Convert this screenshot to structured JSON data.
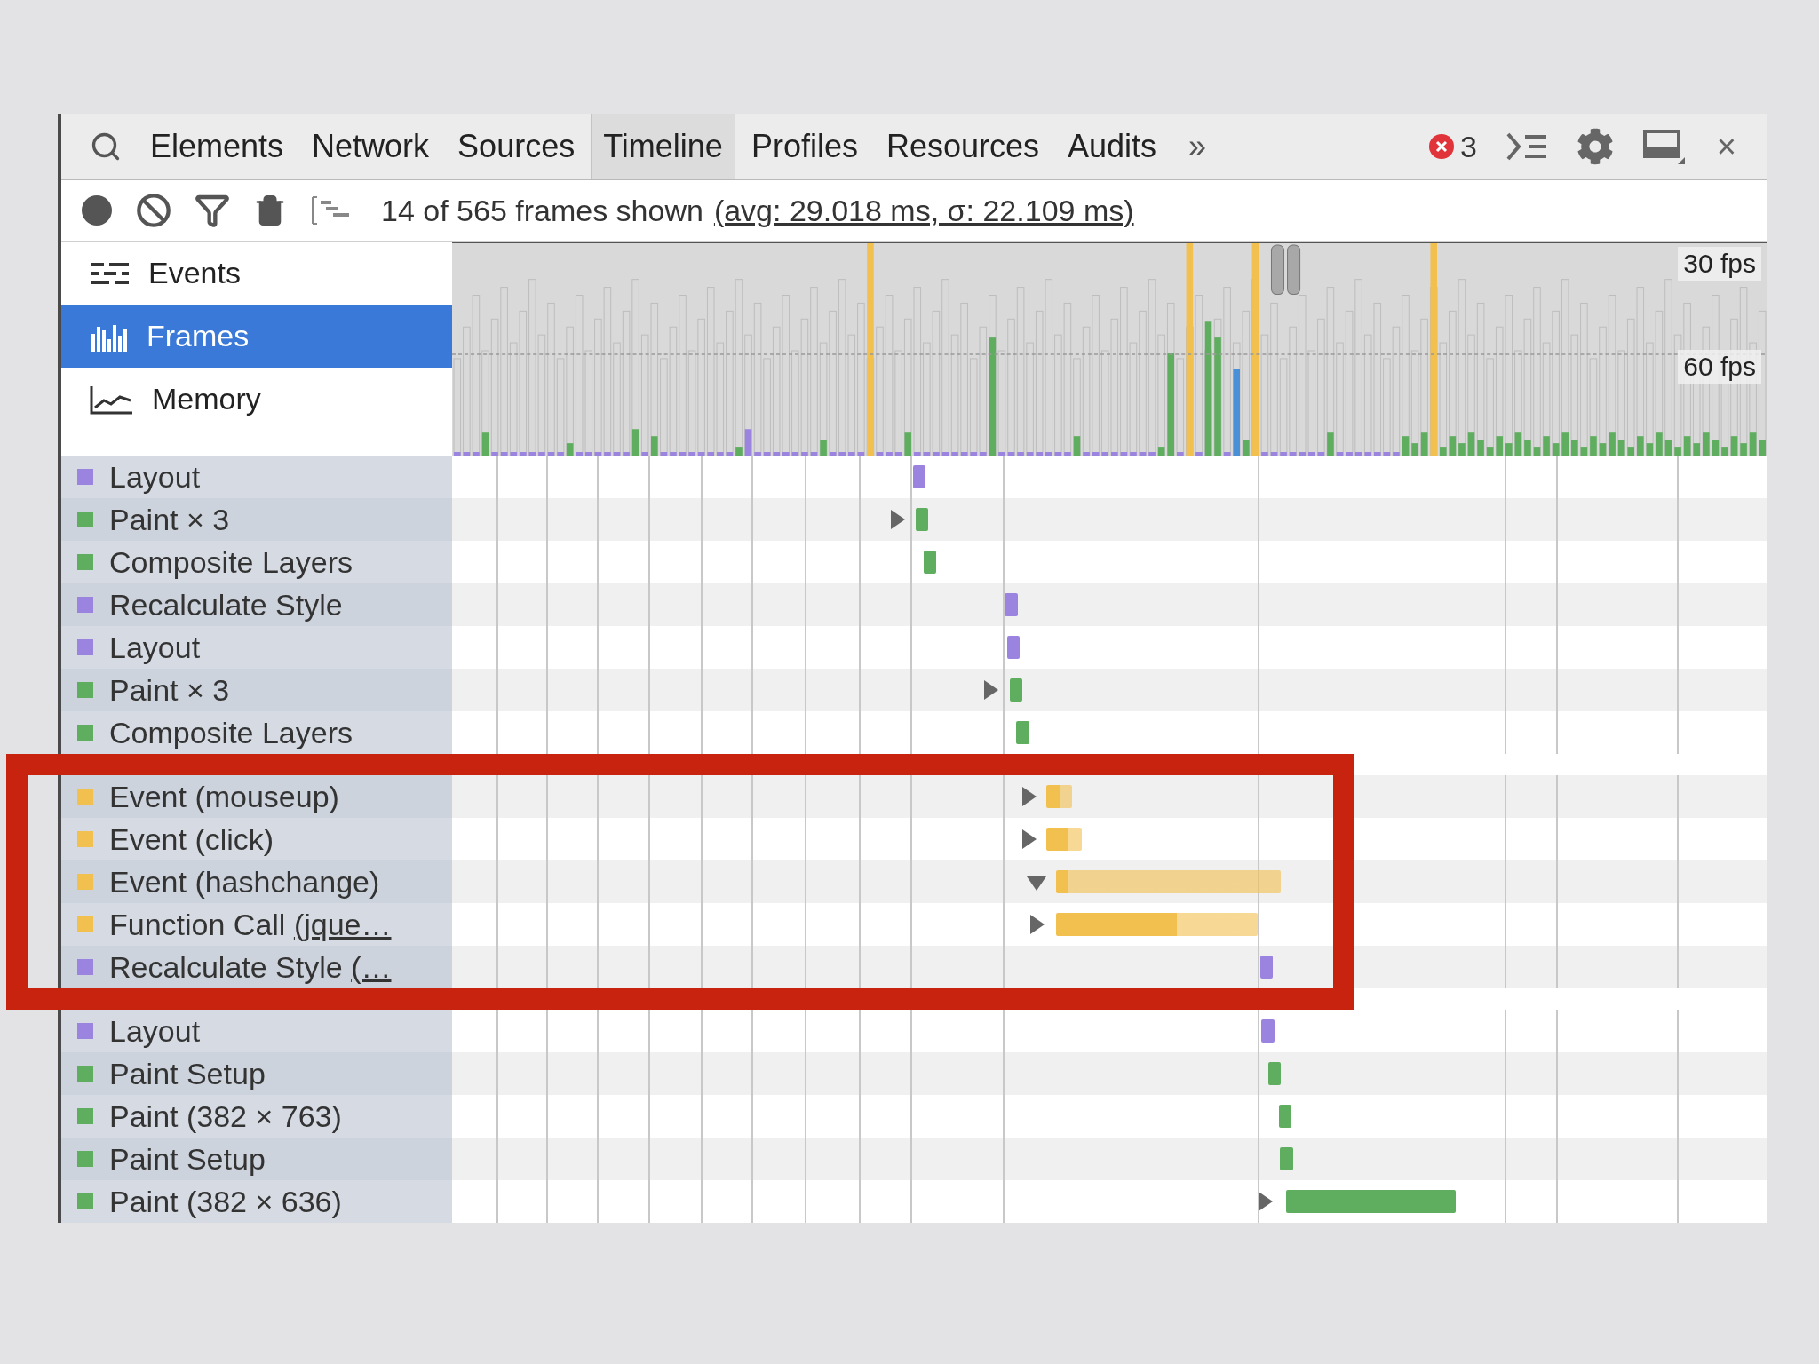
{
  "tabs": {
    "items": [
      {
        "label": "Elements",
        "selected": false
      },
      {
        "label": "Network",
        "selected": false
      },
      {
        "label": "Sources",
        "selected": false
      },
      {
        "label": "Timeline",
        "selected": true
      },
      {
        "label": "Profiles",
        "selected": false
      },
      {
        "label": "Resources",
        "selected": false
      },
      {
        "label": "Audits",
        "selected": false
      }
    ],
    "more": "»"
  },
  "errors": {
    "count": "3"
  },
  "close": "×",
  "toolbar": {
    "summary": "14 of 565 frames shown",
    "stats_link": "(avg: 29.018 ms, σ: 22.109 ms)"
  },
  "views": [
    {
      "label": "Events",
      "kind": "events",
      "selected": false
    },
    {
      "label": "Frames",
      "kind": "frames",
      "selected": true
    },
    {
      "label": "Memory",
      "kind": "memory",
      "selected": false
    }
  ],
  "overview": {
    "labels": [
      "30 fps",
      "60 fps"
    ]
  },
  "record_groups": [
    {
      "highlighted": false,
      "records": [
        {
          "label": "Layout",
          "color": "#9b83e0",
          "kind": "leaf"
        },
        {
          "label": "Paint × 3",
          "color": "#5fae5f",
          "kind": "group",
          "expanded": false
        },
        {
          "label": "Composite Layers",
          "color": "#5fae5f",
          "kind": "leaf"
        },
        {
          "label": "Recalculate Style",
          "color": "#9b83e0",
          "kind": "leaf"
        },
        {
          "label": "Layout",
          "color": "#9b83e0",
          "kind": "leaf"
        },
        {
          "label": "Paint × 3",
          "color": "#5fae5f",
          "kind": "group",
          "expanded": false
        },
        {
          "label": "Composite Layers",
          "color": "#5fae5f",
          "kind": "leaf"
        }
      ]
    },
    {
      "highlighted": true,
      "records": [
        {
          "label": "Event (mouseup)",
          "color": "#f2c04f",
          "kind": "group",
          "expanded": false
        },
        {
          "label": "Event (click)",
          "color": "#f2c04f",
          "kind": "group",
          "expanded": false
        },
        {
          "label": "Event (hashchange)",
          "color": "#f2c04f",
          "kind": "group",
          "expanded": true
        },
        {
          "label": "Function Call ",
          "link": "(jque…",
          "color": "#f2c04f",
          "kind": "group",
          "expanded": false
        },
        {
          "label": "Recalculate Style ",
          "link": "(…",
          "color": "#9b83e0",
          "kind": "leaf"
        }
      ]
    },
    {
      "highlighted": false,
      "records": [
        {
          "label": "Layout",
          "color": "#9b83e0",
          "kind": "leaf"
        },
        {
          "label": "Paint Setup",
          "color": "#5fae5f",
          "kind": "leaf"
        },
        {
          "label": "Paint (382 × 763)",
          "color": "#5fae5f",
          "kind": "leaf"
        },
        {
          "label": "Paint Setup",
          "color": "#5fae5f",
          "kind": "leaf"
        },
        {
          "label": "Paint (382 × 636)",
          "color": "#5fae5f",
          "kind": "group",
          "expanded": false
        }
      ]
    }
  ]
}
